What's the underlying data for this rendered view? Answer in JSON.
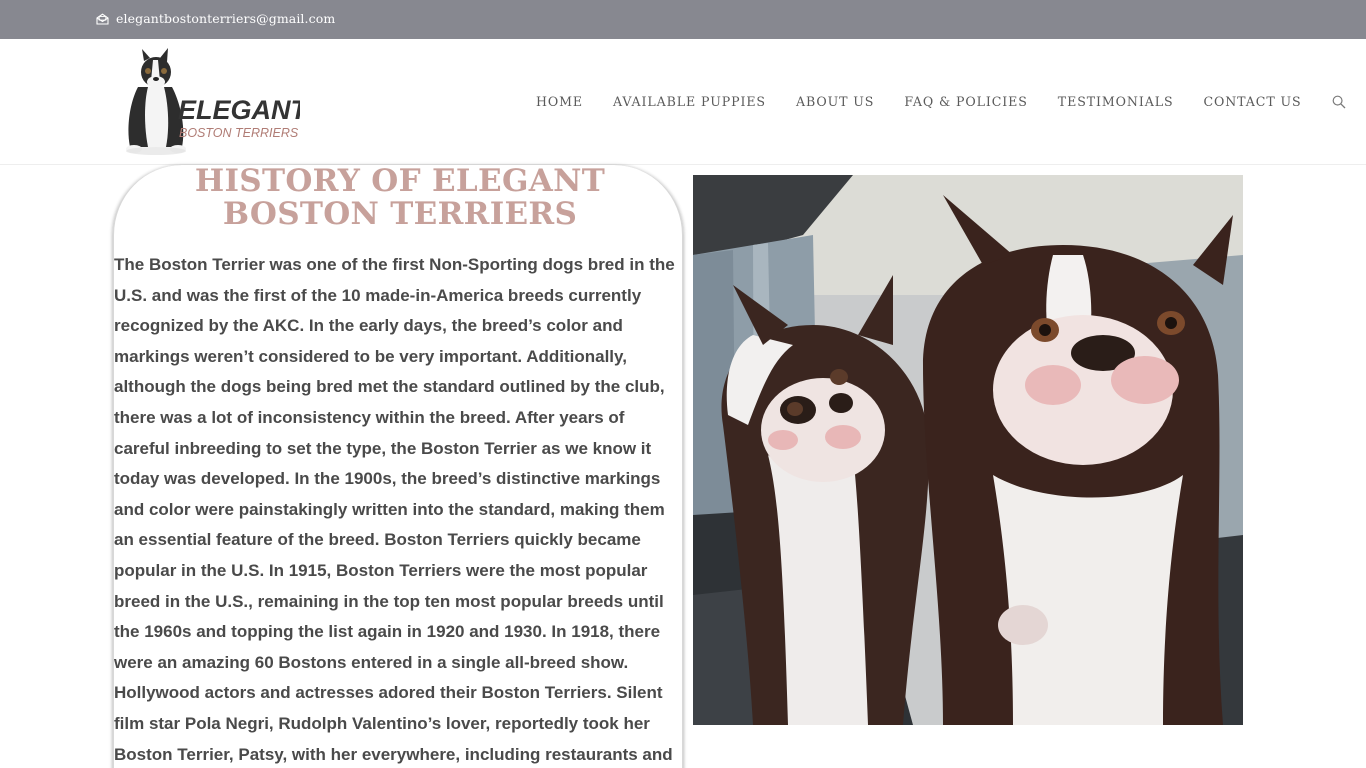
{
  "topbar": {
    "email": "elegantbostonterriers@gmail.com",
    "email_icon": "envelope-icon",
    "background": "#878890"
  },
  "header": {
    "logo": {
      "word1": "ELEGANT",
      "word2": "BOSTON TERRIERS",
      "icon": "boston-terrier-logo"
    },
    "nav": [
      {
        "label": "HOME"
      },
      {
        "label": "AVAILABLE PUPPIES"
      },
      {
        "label": "ABOUT US"
      },
      {
        "label": "FAQ & POLICIES"
      },
      {
        "label": "TESTIMONIALS"
      },
      {
        "label": "CONTACT US"
      }
    ],
    "search_icon": "search-icon"
  },
  "article": {
    "title": "HISTORY OF ELEGANT BOSTON TERRIERS",
    "body": "The Boston Terrier was one of the first Non-Sporting dogs bred in the U.S. and was the first of the 10 made-in-America breeds currently recognized by the AKC. In the early days, the breed’s color and markings weren’t considered to be very important. Additionally, although the dogs being bred met the standard outlined by the club, there was a lot of inconsistency within the breed. After years of careful inbreeding to set the type, the Boston Terrier as we know it today was developed. In the 1900s, the breed’s distinctive markings and color were painstakingly written into the standard, making them an essential feature of the breed. Boston Terriers quickly became popular in the U.S. In 1915, Boston Terriers were the most popular breed in the U.S., remaining in the top ten most popular breeds until the 1960s and topping the list again in 1920 and 1930. In 1918, there were an amazing 60 Bostons entered in a single all-breed show. Hollywood actors and actresses adored their Boston Terriers. Silent film star Pola Negri, Rudolph Valentino’s lover, reportedly took her Boston Terrier, Patsy, with her everywhere, including restaurants and",
    "title_color": "#c7a19b",
    "text_color": "#4a4a4a"
  },
  "photo": {
    "subject": "two-boston-terriers-photo"
  }
}
